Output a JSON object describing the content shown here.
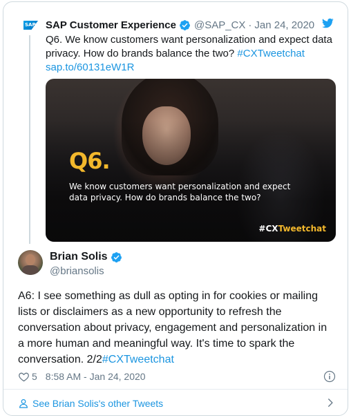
{
  "parent_tweet": {
    "logo_text": "SAP",
    "author_name": "SAP Customer Experience",
    "handle": "@SAP_CX",
    "separator": "·",
    "date": "Jan 24, 2020",
    "text": "Q6. We know customers want personalization and expect data privacy. How do brands balance the two? ",
    "hashtag": "#CXTweetchat",
    "link": "sap.to/60131eW1R",
    "media": {
      "heading": "Q6.",
      "body": "We know customers want personalization and expect data privacy. How do brands balance the two?",
      "tag_prefix": "#CX",
      "tag_suffix": "Tweetchat"
    }
  },
  "tweet": {
    "author_name": "Brian Solis",
    "handle": "@briansolis",
    "text": "A6: I see something as dull as opting in for cookies or mailing lists or disclaimers as a new opportunity to refresh the conversation about privacy, engagement and personalization in a more human and meaningful way. It's time to spark the conversation. 2/2",
    "hashtag": "#CXTweetchat",
    "likes": "5",
    "timestamp": "8:58 AM - Jan 24, 2020"
  },
  "footer": {
    "label": "See Brian Solis's other Tweets"
  },
  "colors": {
    "link": "#1b95e0",
    "verified": "#1da1f2",
    "muted": "#657786",
    "accent": "#f3b82c"
  },
  "icons": [
    "verified-badge-icon",
    "twitter-bird-icon",
    "heart-icon",
    "info-icon",
    "user-icon",
    "chevron-right-icon"
  ]
}
